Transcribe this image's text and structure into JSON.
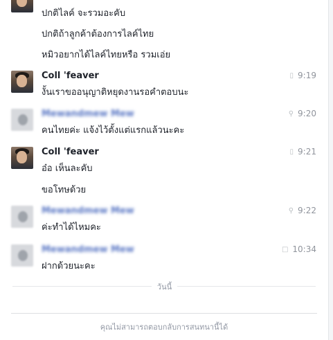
{
  "messages": [
    {
      "sender": "",
      "sender_blurred": false,
      "avatar": "coll-feaver-avatar",
      "time": "",
      "lines": [
        "ปกติไลค์ จะรวมอะคับ",
        "ปกติถ้าลูกค้าต้องการไลค์ไทย",
        "หมิวอยากได้ไลค์ไทยหรือ รวมเอ่ย"
      ]
    },
    {
      "sender": "Coll 'feaver",
      "sender_blurred": false,
      "avatar": "coll-feaver-avatar",
      "time": "9:19",
      "icon": "mobile-icon",
      "lines": [
        "งั้นเราขออนุญาติหยุดงานรอคำตอบนะ"
      ]
    },
    {
      "sender": "Mewandmew Mew",
      "sender_blurred": true,
      "avatar": "blurred-avatar",
      "time": "9:20",
      "icon": "location-pin-icon",
      "lines": [
        "คนไทยค่ะ แจ้งไว้ตั้งแต่แรกแล้วนะคะ"
      ]
    },
    {
      "sender": "Coll 'feaver",
      "sender_blurred": false,
      "avatar": "coll-feaver-avatar",
      "time": "9:21",
      "icon": "mobile-icon",
      "lines": [
        "อ๋อ เห็นละคับ",
        "ขอโทษด้วย"
      ]
    },
    {
      "sender": "Mewandmew Mew",
      "sender_blurred": true,
      "avatar": "blurred-avatar",
      "time": "9:22",
      "icon": "location-pin-icon",
      "lines": [
        "ค่ะทำได้ไหมคะ"
      ]
    },
    {
      "sender": "Mewandmew Mew",
      "sender_blurred": true,
      "avatar": "blurred-avatar",
      "time": "10:34",
      "icon": "chat-bubble-icon",
      "lines": [
        "ฝากด้วยนะคะ"
      ]
    }
  ],
  "divider_label": "วันนี้",
  "footer_notice": "คุณไม่สามารถตอบกลับการสนทนานี้ได้"
}
